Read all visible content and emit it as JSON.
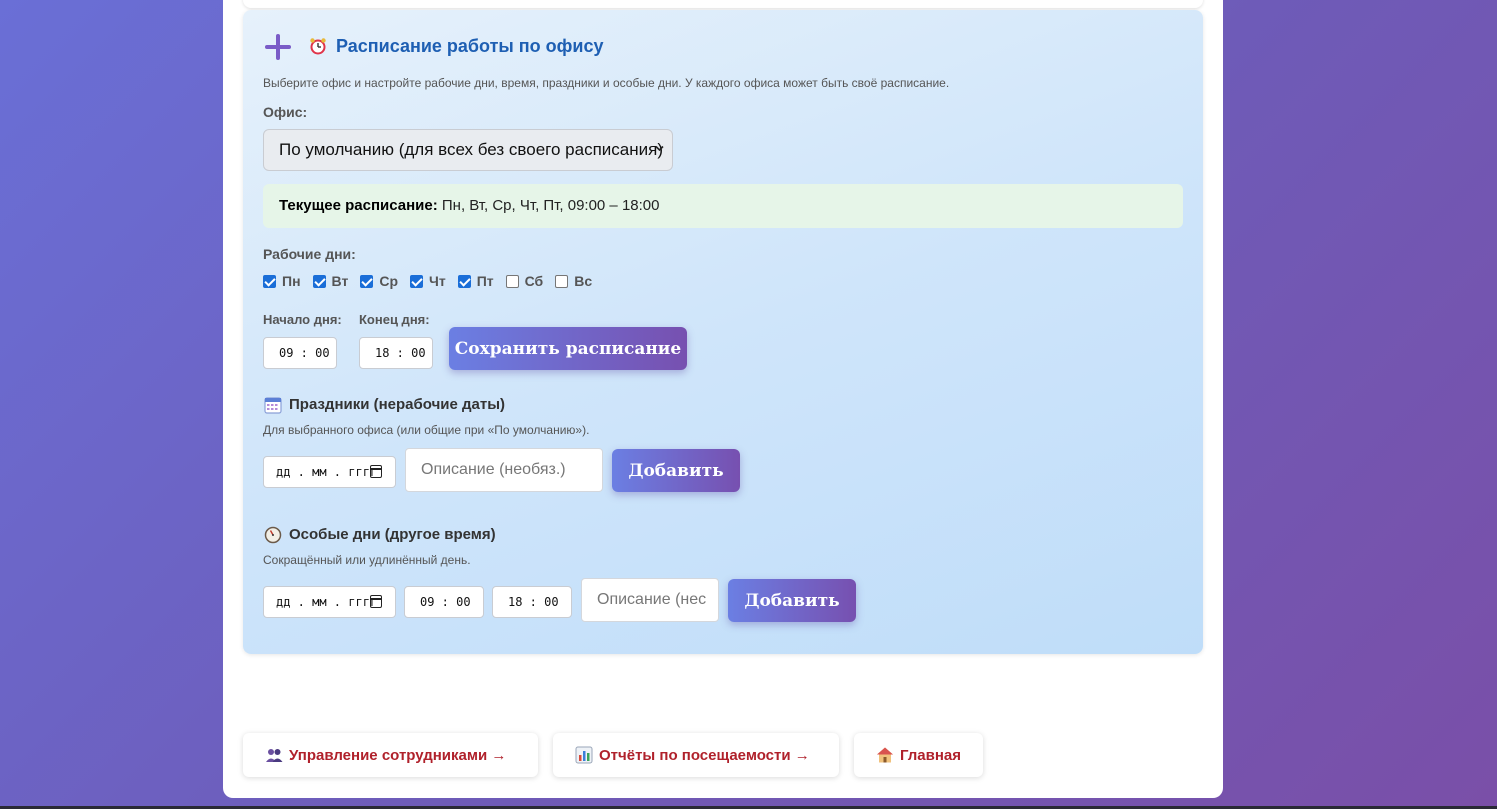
{
  "schedule": {
    "title": "Расписание работы по офису",
    "description": "Выберите офис и настройте рабочие дни, время, праздники и особые дни. У каждого офиса может быть своё расписание.",
    "office_label": "Офис:",
    "office_selected": "По умолчанию (для всех без своего расписания)",
    "current_label": "Текущее расписание:",
    "current_value": " Пн, Вт, Ср, Чт, Пт, 09:00 – 18:00",
    "workdays_label": "Рабочие дни:",
    "days": [
      {
        "label": "Пн",
        "checked": true
      },
      {
        "label": "Вт",
        "checked": true
      },
      {
        "label": "Ср",
        "checked": true
      },
      {
        "label": "Чт",
        "checked": true
      },
      {
        "label": "Пт",
        "checked": true
      },
      {
        "label": "Сб",
        "checked": false
      },
      {
        "label": "Вс",
        "checked": false
      }
    ],
    "start_label": "Начало дня:",
    "start_value": "09 : 00",
    "end_label": "Конец дня:",
    "end_value": "18 : 00",
    "save_button": "Сохранить расписание"
  },
  "holidays": {
    "title": "Праздники (нерабочие даты)",
    "note": "Для выбранного офиса (или общие при «По умолчанию»).",
    "date_placeholder": "дд . мм . гггг",
    "description_placeholder": "Описание (необяз.)",
    "add_button": "Добавить"
  },
  "special_days": {
    "title": "Особые дни (другое время)",
    "note": "Сокращённый или удлинённый день.",
    "date_placeholder": "дд . мм . гггг",
    "start_value": "09 : 00",
    "end_value": "18 : 00",
    "description_placeholder": "Описание (нес",
    "add_button": "Добавить"
  },
  "nav": {
    "employees": "Управление сотрудниками →",
    "reports": "Отчёты по посещаемости →",
    "home": "Главная"
  },
  "icons": {
    "plus": "plus-icon",
    "alarm": "alarm-clock-icon",
    "calendar": "calendar-icon",
    "stopwatch": "stopwatch-icon",
    "employees": "people-icon",
    "reports": "bar-chart-icon",
    "home": "house-icon"
  },
  "colors": {
    "title_blue": "#1e5fb3",
    "button_gradient_start": "#6b7fe3",
    "button_gradient_end": "#7750b0",
    "nav_text": "#b0212b",
    "checkbox": "#1a6ed8"
  }
}
